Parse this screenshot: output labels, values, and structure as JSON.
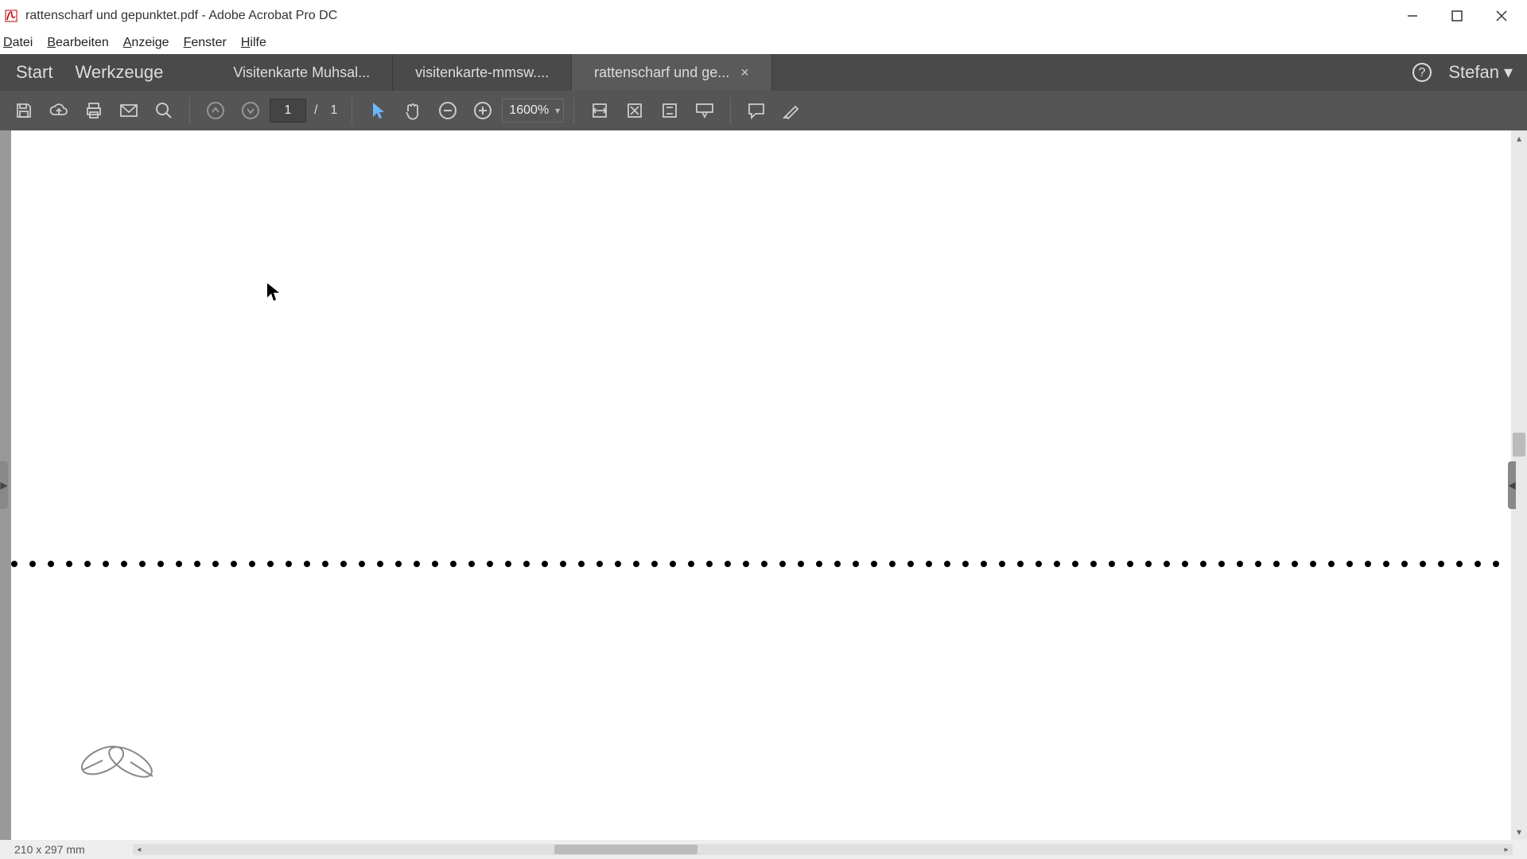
{
  "window": {
    "title": "rattenscharf und gepunktet.pdf - Adobe Acrobat Pro DC"
  },
  "menus": {
    "file": "Datei",
    "edit": "Bearbeiten",
    "view": "Anzeige",
    "window": "Fenster",
    "help": "Hilfe"
  },
  "nav": {
    "start": "Start",
    "tools": "Werkzeuge"
  },
  "tabs": [
    {
      "label": "Visitenkarte Muhsal..."
    },
    {
      "label": "visitenkarte-mmsw...."
    },
    {
      "label": "rattenscharf und ge...",
      "active": true
    }
  ],
  "user": {
    "name": "Stefan"
  },
  "page": {
    "current": "1",
    "separator": "/",
    "total": "1"
  },
  "zoom": {
    "value": "1600%"
  },
  "status": {
    "page_size": "210 x 297 mm"
  }
}
